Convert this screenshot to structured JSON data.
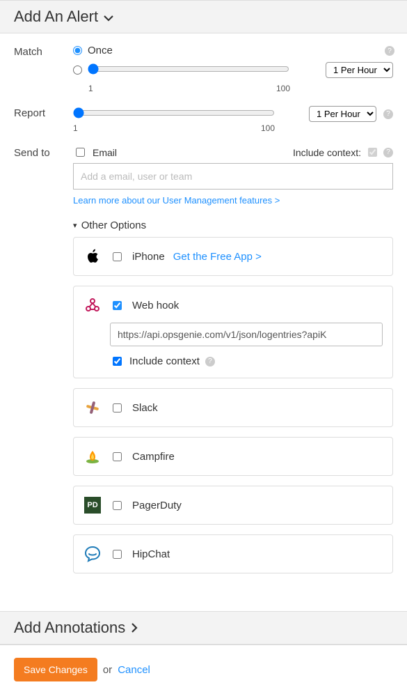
{
  "sections": {
    "alert_title": "Add An Alert",
    "annotations_title": "Add Annotations"
  },
  "match": {
    "label": "Match",
    "once": "Once",
    "slider_min": "1",
    "slider_max": "100",
    "rate": "1 Per Hour"
  },
  "report": {
    "label": "Report",
    "slider_min": "1",
    "slider_max": "100",
    "rate": "1 Per Hour"
  },
  "sendto": {
    "label": "Send to",
    "email_label": "Email",
    "include_context": "Include context:",
    "email_placeholder": "Add a email, user or team",
    "learn_more": "Learn more about our User Management features >",
    "other_options": "Other Options"
  },
  "options": {
    "iphone": {
      "label": "iPhone",
      "link": "Get the Free App >"
    },
    "webhook": {
      "label": "Web hook",
      "url": "https://api.opsgenie.com/v1/json/logentries?apiK",
      "include_context": "Include context"
    },
    "slack": {
      "label": "Slack"
    },
    "campfire": {
      "label": "Campfire"
    },
    "pagerduty": {
      "label": "PagerDuty"
    },
    "hipchat": {
      "label": "HipChat"
    }
  },
  "footer": {
    "save": "Save Changes",
    "or": "or",
    "cancel": "Cancel"
  }
}
